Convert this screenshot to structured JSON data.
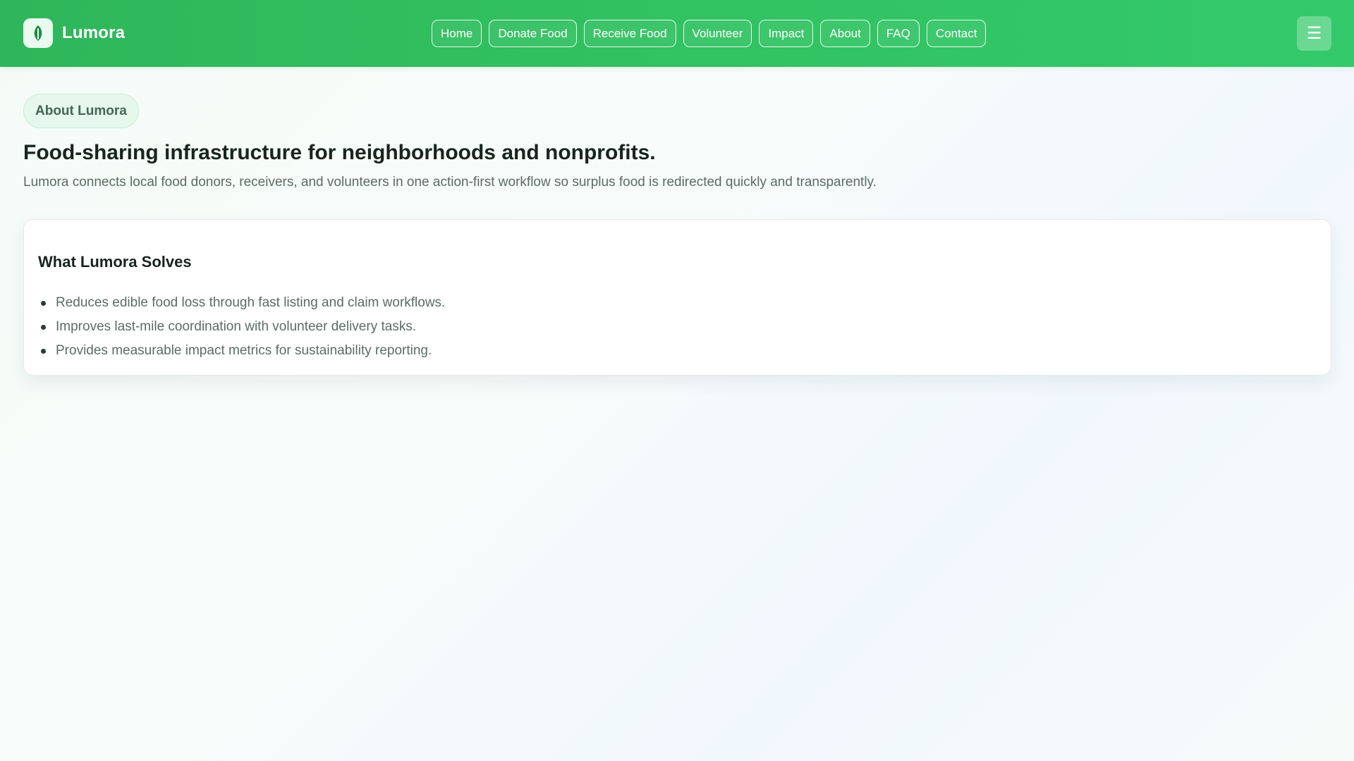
{
  "header": {
    "brand": "Lumora",
    "logo_icon": "leaf-icon",
    "menu_icon": "hamburger-menu-icon",
    "menu_glyph": "☰",
    "nav": [
      {
        "label": "Home"
      },
      {
        "label": "Donate Food"
      },
      {
        "label": "Receive Food"
      },
      {
        "label": "Volunteer"
      },
      {
        "label": "Impact"
      },
      {
        "label": "About"
      },
      {
        "label": "FAQ"
      },
      {
        "label": "Contact"
      }
    ]
  },
  "main": {
    "badge": "About Lumora",
    "headline": "Food-sharing infrastructure for neighborhoods and nonprofits.",
    "subline": "Lumora connects local food donors, receivers, and volunteers in one action-first workflow so surplus food is redirected quickly and transparently.",
    "card": {
      "title": "What Lumora Solves",
      "items": [
        "Reduces edible food loss through fast listing and claim workflows.",
        "Improves last-mile coordination with volunteer delivery tasks.",
        "Provides measurable impact metrics for sustainability reporting."
      ]
    }
  },
  "colors": {
    "brand_green": "#2fb65a",
    "accent_dark_green": "#1f8a43",
    "badge_bg": "#e6f7ec"
  }
}
